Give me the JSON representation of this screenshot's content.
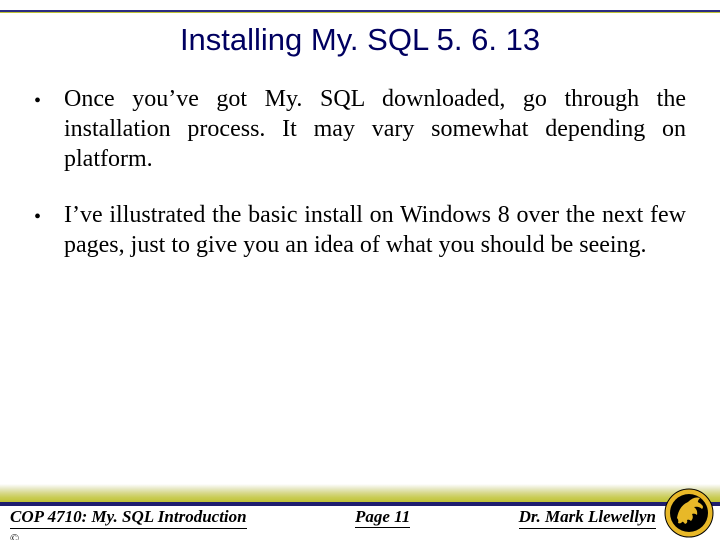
{
  "title": "Installing My. SQL 5. 6. 13",
  "bullets": [
    "Once you’ve got My. SQL downloaded, go through the installation process.  It may vary somewhat depending on platform.",
    "I’ve illustrated the basic install on Windows 8 over the next few pages, just to give you an idea of what you should be seeing."
  ],
  "footer": {
    "left": "COP 4710: My. SQL Introduction",
    "center": "Page 11",
    "right": "Dr. Mark Llewellyn"
  }
}
